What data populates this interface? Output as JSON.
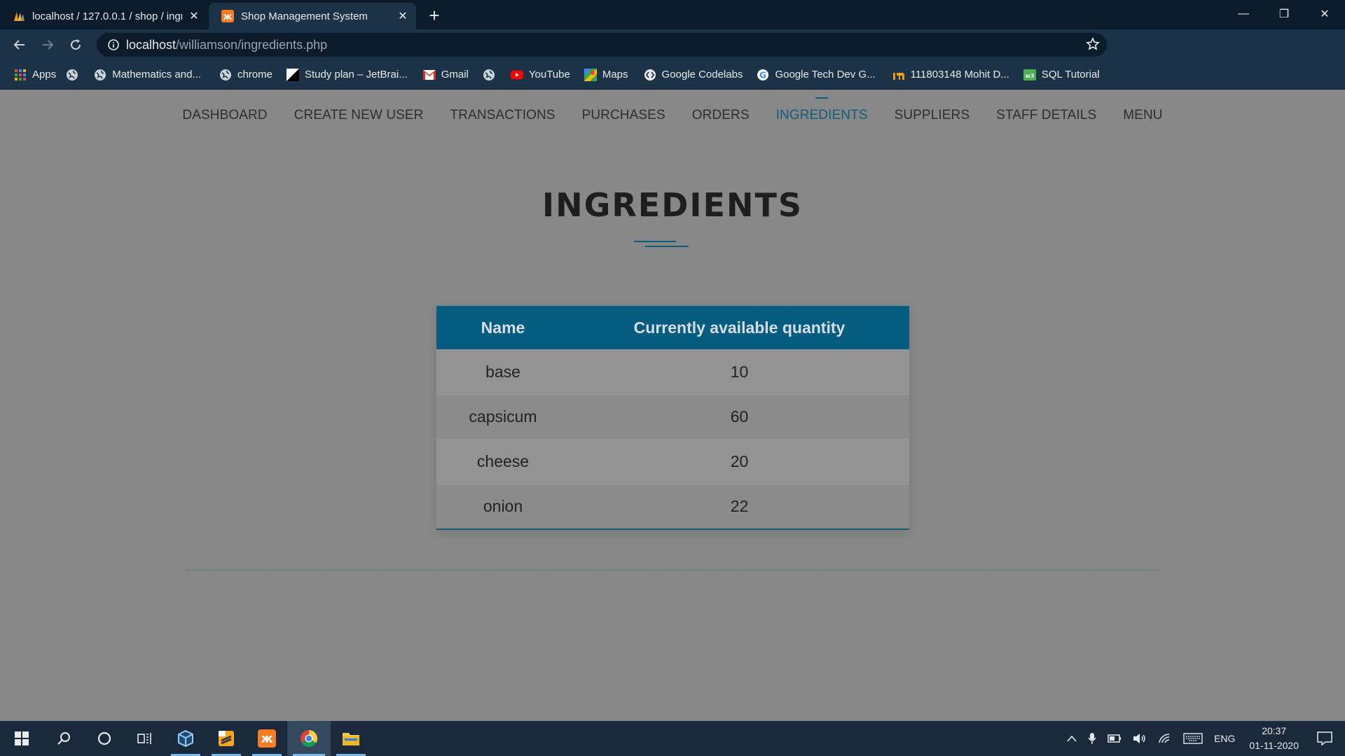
{
  "browser": {
    "tabs": [
      {
        "title": "localhost / 127.0.0.1 / shop / ingr",
        "favicon": "phpmyadmin-icon",
        "active": false
      },
      {
        "title": "Shop Management System",
        "favicon": "xampp-icon",
        "active": true
      }
    ],
    "url_host": "localhost",
    "url_path": "/williamson/ingredients.php",
    "bookmarks": [
      {
        "label": "Apps",
        "icon": "apps-grid-icon"
      },
      {
        "label": "",
        "icon": "globe-icon"
      },
      {
        "label": "Mathematics and...",
        "icon": "globe-icon"
      },
      {
        "label": "chrome",
        "icon": "globe-icon"
      },
      {
        "label": "Study plan – JetBrai...",
        "icon": "jetbrains-icon"
      },
      {
        "label": "Gmail",
        "icon": "gmail-icon"
      },
      {
        "label": "",
        "icon": "globe-icon"
      },
      {
        "label": "YouTube",
        "icon": "youtube-icon"
      },
      {
        "label": "Maps",
        "icon": "maps-icon"
      },
      {
        "label": "Google Codelabs",
        "icon": "codelabs-icon"
      },
      {
        "label": "Google Tech Dev G...",
        "icon": "google-icon"
      },
      {
        "label": "111803148 Mohit D...",
        "icon": "site-icon"
      },
      {
        "label": "SQL Tutorial",
        "icon": "sql-icon"
      }
    ]
  },
  "nav": {
    "items": [
      "DASHBOARD",
      "CREATE NEW USER",
      "TRANSACTIONS",
      "PURCHASES",
      "ORDERS",
      "INGREDIENTS",
      "SUPPLIERS",
      "STAFF DETAILS",
      "MENU"
    ],
    "active": "INGREDIENTS"
  },
  "page": {
    "title": "INGREDIENTS",
    "table": {
      "headers": [
        "Name",
        "Currently available quantity"
      ],
      "rows": [
        [
          "base",
          "10"
        ],
        [
          "capsicum",
          "60"
        ],
        [
          "cheese",
          "20"
        ],
        [
          "onion",
          "22"
        ]
      ]
    }
  },
  "taskbar": {
    "lang": "ENG",
    "time": "20:37",
    "date": "01-11-2020"
  },
  "colors": {
    "accent": "#0f5d7b",
    "table_header_bg": "#045c7e",
    "page_bg": "#888888"
  }
}
